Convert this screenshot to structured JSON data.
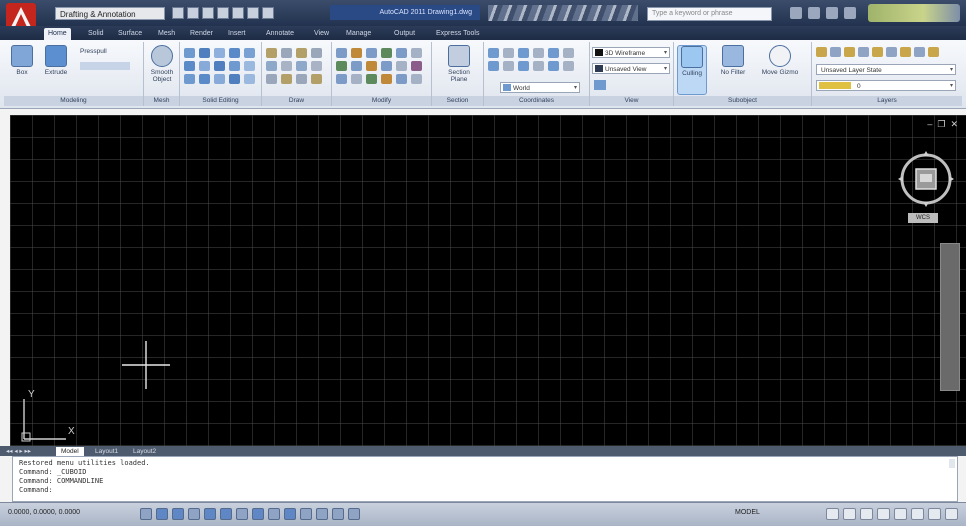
{
  "titlebar": {
    "workspace": "Drafting & Annotation",
    "app_title": "AutoCAD 2011  Drawing1.dwg",
    "search_placeholder": "Type a keyword or phrase"
  },
  "tabs": [
    "Home",
    "Solid",
    "Surface",
    "Mesh",
    "Render",
    "Insert",
    "Annotate",
    "View",
    "Manage",
    "Output",
    "Express Tools"
  ],
  "ribbon": {
    "modeling": {
      "box_label": "Box",
      "extrude_label": "Extrude",
      "presspull_label": "Presspull",
      "footer": "Modeling"
    },
    "mesh": {
      "smooth_label": "Smooth Object",
      "footer": "Mesh"
    },
    "solid_editing_footer": "Solid Editing",
    "draw_footer": "Draw",
    "modify_footer": "Modify",
    "section": {
      "plane_label": "Section Plane",
      "footer": "Section"
    },
    "coordinates": {
      "world_label": "World",
      "footer": "Coordinates"
    },
    "view": {
      "visual_style": "3D Wireframe",
      "view_name": "Unsaved View",
      "footer": "View"
    },
    "subobject": {
      "culling_label": "Culling",
      "nofilter_label": "No Filter",
      "gizmo_label": "Move Gizmo",
      "footer": "Subobject"
    },
    "layers": {
      "layer_state": "Unsaved Layer State",
      "current_layer": "0",
      "footer": "Layers"
    }
  },
  "drawing": {
    "wcs_label": "WCS",
    "ucs_x": "X",
    "ucs_y": "Y"
  },
  "layout_tabs": [
    "Model",
    "Layout1",
    "Layout2"
  ],
  "command_lines": [
    "Restored menu utilities loaded.",
    "Command:  _CUBOID",
    "Command:  COMMANDLINE",
    "Command:"
  ],
  "status": {
    "coords": "0.0000, 0.0000, 0.0000",
    "model": "MODEL"
  },
  "colors": {
    "canvas": "#000000",
    "grid": "#464646",
    "titlebar": "#22324f",
    "ribbon": "#eef2f8",
    "crosshair": "#e8e8e8"
  }
}
